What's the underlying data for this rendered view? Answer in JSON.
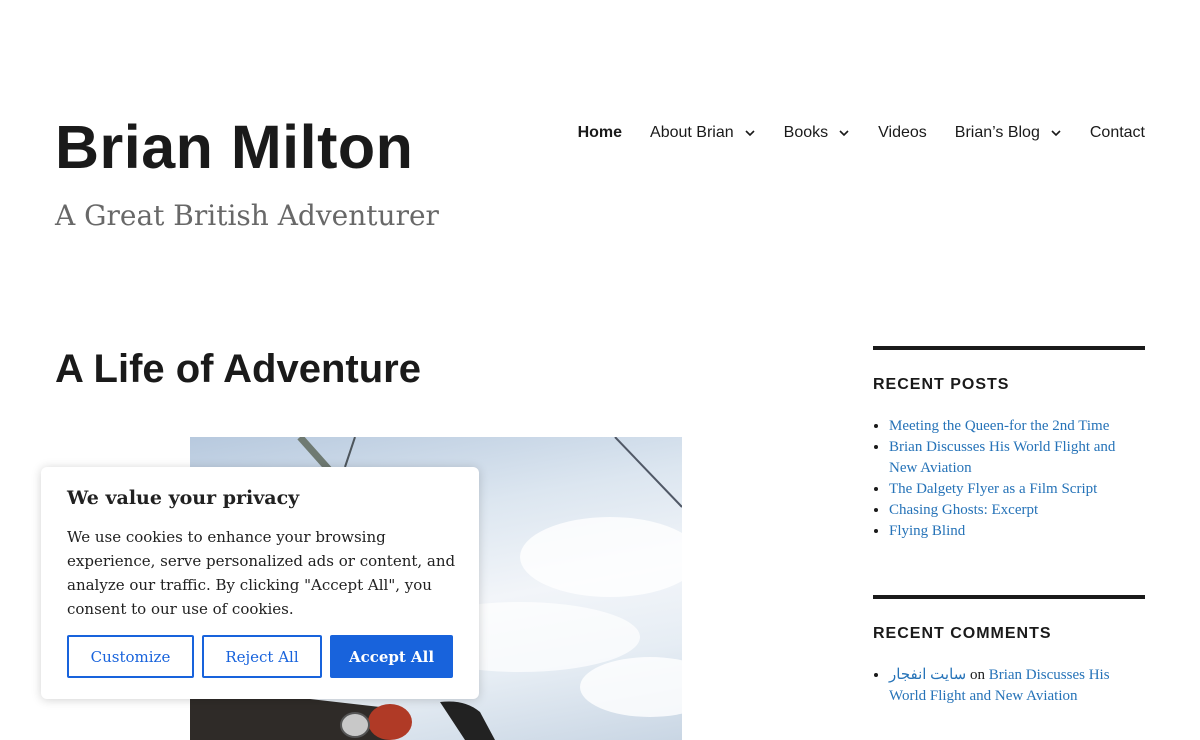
{
  "site": {
    "title": "Brian Milton",
    "tagline": "A Great British Adventurer"
  },
  "nav": {
    "items": [
      {
        "label": "Home",
        "active": true,
        "has_submenu": false
      },
      {
        "label": "About Brian",
        "active": false,
        "has_submenu": true
      },
      {
        "label": "Books",
        "active": false,
        "has_submenu": true
      },
      {
        "label": "Videos",
        "active": false,
        "has_submenu": false
      },
      {
        "label": "Brian’s Blog",
        "active": false,
        "has_submenu": true
      },
      {
        "label": "Contact",
        "active": false,
        "has_submenu": false
      }
    ]
  },
  "main": {
    "title": "A Life of Adventure"
  },
  "sidebar": {
    "recent_posts": {
      "title": "RECENT POSTS",
      "items": [
        "Meeting the Queen-for the 2nd Time",
        "Brian Discusses His World Flight and New Aviation",
        "The Dalgety Flyer as a Film Script",
        "Chasing Ghosts: Excerpt",
        "Flying Blind"
      ]
    },
    "recent_comments": {
      "title": "RECENT COMMENTS",
      "author": "سایت انفجار",
      "on_word": "on",
      "post": "Brian Discusses His World Flight and New Aviation"
    }
  },
  "cookie": {
    "title": "We value your privacy",
    "text": "We use cookies to enhance your browsing experience, serve personalized ads or content, and analyze our traffic. By clicking \"Accept All\", you consent to our use of cookies.",
    "customize": "Customize",
    "reject": "Reject All",
    "accept": "Accept All"
  },
  "colors": {
    "link": "#2673b8",
    "accent_button": "#1863dc",
    "text": "#1a1a1a",
    "tagline": "#686868"
  }
}
